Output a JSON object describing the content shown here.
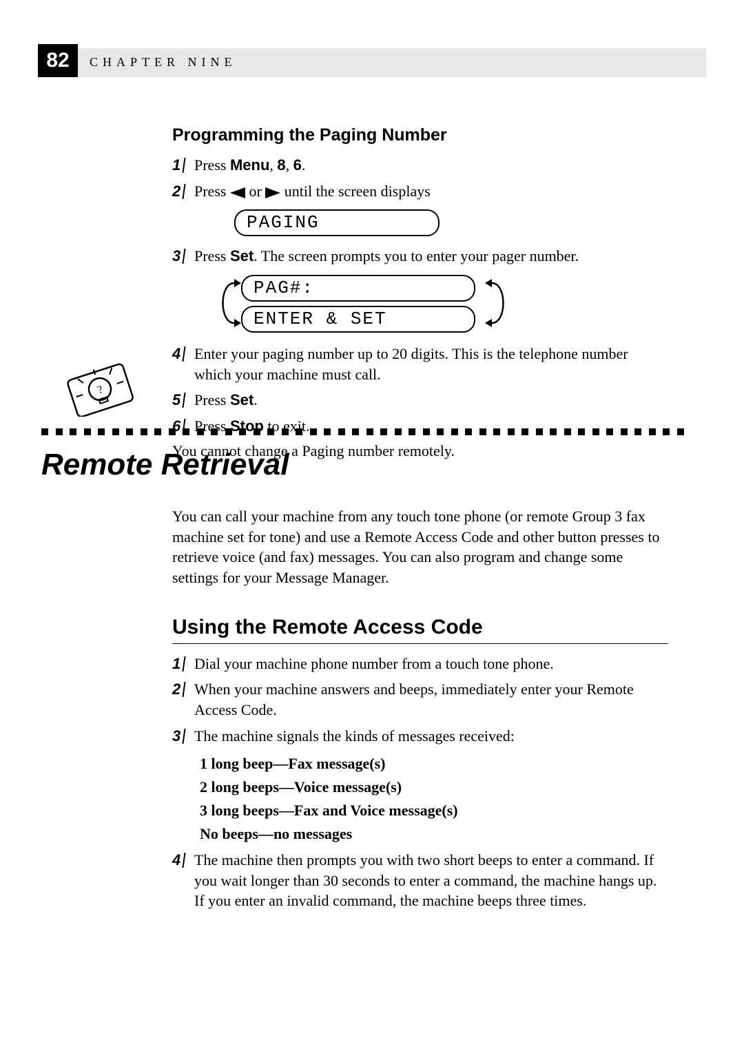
{
  "header": {
    "page_number": "82",
    "chapter_label": "CHAPTER NINE"
  },
  "section1": {
    "title": "Programming the Paging Number",
    "steps": {
      "s1": {
        "num": "1",
        "pre": "Press ",
        "b1": "Menu",
        "mid1": ", ",
        "b2": "8",
        "mid2": ", ",
        "b3": "6",
        "post": "."
      },
      "s2": {
        "num": "2",
        "pre": "Press ",
        "mid": " or ",
        "post": " until the screen displays"
      },
      "lcd1": "PAGING",
      "s3": {
        "num": "3",
        "pre": "Press ",
        "b1": "Set",
        "post": ". The screen prompts you to enter your pager number."
      },
      "lcd2a": "PAG#:",
      "lcd2b": "ENTER & SET",
      "s4": {
        "num": "4",
        "text": "Enter your paging number up to 20 digits. This is the telephone number which your machine must call."
      },
      "s5": {
        "num": "5",
        "pre": "Press ",
        "b1": "Set",
        "post": "."
      },
      "s6": {
        "num": "6",
        "pre": "Press ",
        "b1": "Stop",
        "post": " to exit."
      }
    },
    "note": "You cannot change a Paging number remotely."
  },
  "section2": {
    "title": "Remote Retrieval",
    "intro": "You can call your machine from any touch tone phone (or remote Group 3 fax machine set for tone) and use a Remote Access Code and other button presses to retrieve voice (and fax) messages. You can also program and change some settings for your Message Manager.",
    "sub": "Using the Remote Access Code",
    "steps": {
      "s1": {
        "num": "1",
        "text": "Dial your machine phone number from a touch tone phone."
      },
      "s2": {
        "num": "2",
        "text": "When your machine answers and beeps, immediately enter your Remote Access Code."
      },
      "s3": {
        "num": "3",
        "text": "The machine signals the kinds of messages received:"
      },
      "signals": {
        "a": "1 long beep—Fax message(s)",
        "b": "2 long beeps—Voice message(s)",
        "c": "3 long beeps—Fax and Voice message(s)",
        "d": "No beeps—no messages"
      },
      "s4": {
        "num": "4",
        "text": "The machine then prompts you with two short beeps to enter a command. If you wait longer than 30 seconds to enter a command, the machine hangs up. If you enter an invalid command, the machine beeps three times."
      }
    }
  }
}
